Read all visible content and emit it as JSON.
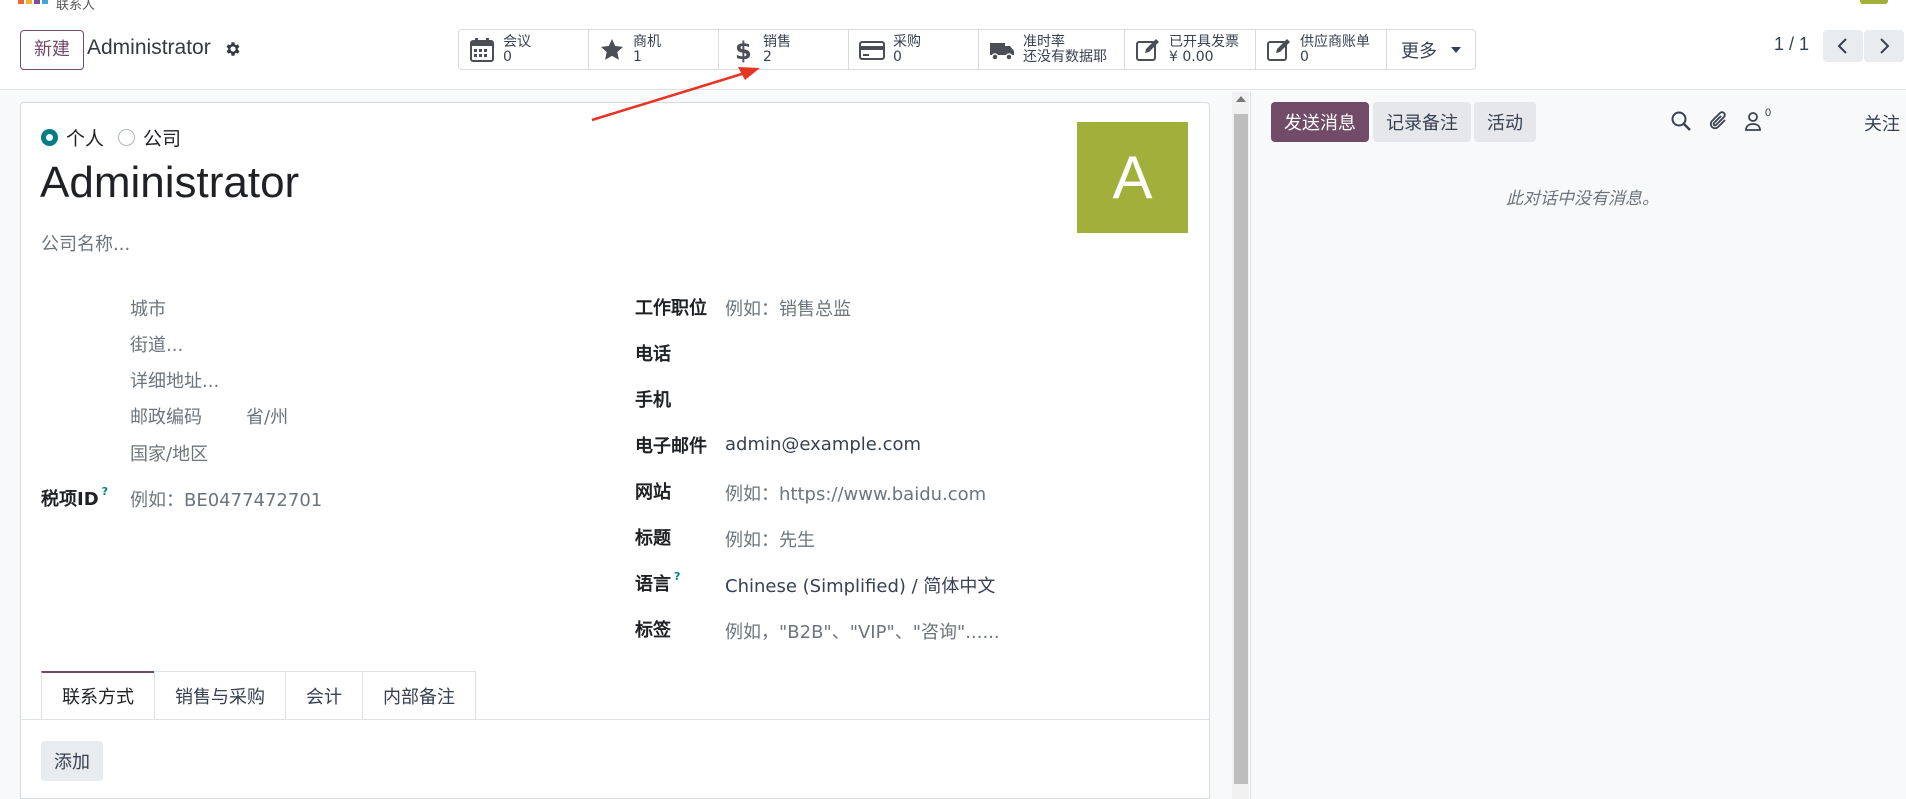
{
  "app": {
    "brand_colors": [
      "#e8663b",
      "#f2b134",
      "#7c4f99",
      "#3fa7d6"
    ],
    "top_label": "联系人"
  },
  "control": {
    "new_label": "新建",
    "breadcrumb": "Administrator",
    "smart_buttons": [
      {
        "icon": "calendar-icon",
        "label": "会议",
        "value": "0"
      },
      {
        "icon": "star-icon",
        "label": "商机",
        "value": "1"
      },
      {
        "icon": "dollar-icon",
        "label": "销售",
        "value": "2"
      },
      {
        "icon": "credit-card-icon",
        "label": "采购",
        "value": "0"
      },
      {
        "icon": "truck-icon",
        "label": "准时率",
        "value": "还没有数据耶"
      },
      {
        "icon": "invoice-edit-icon",
        "label": "已开具发票",
        "value": "¥ 0.00"
      },
      {
        "icon": "bill-edit-icon",
        "label": "供应商账单",
        "value": "0"
      }
    ],
    "more_label": "更多",
    "pager": "1 / 1"
  },
  "form": {
    "type_individual": "个人",
    "type_company": "公司",
    "name": "Administrator",
    "avatar_letter": "A",
    "company_placeholder": "公司名称...",
    "address": {
      "city": "城市",
      "street": "街道...",
      "street2": "详细地址...",
      "zip": "邮政编码",
      "state": "省/州",
      "country": "国家/地区"
    },
    "vat_label": "税项ID",
    "vat_help": "?",
    "vat_placeholder": "例如：BE0477472701",
    "right": {
      "job_label": "工作职位",
      "job_placeholder": "例如：销售总监",
      "phone_label": "电话",
      "mobile_label": "手机",
      "email_label": "电子邮件",
      "email_value": "admin@example.com",
      "website_label": "网站",
      "website_placeholder": "例如：https://www.baidu.com",
      "title_label": "标题",
      "title_placeholder": "例如：先生",
      "lang_label": "语言",
      "lang_help": "?",
      "lang_value": "Chinese (Simplified) / 简体中文",
      "tags_label": "标签",
      "tags_placeholder": "例如，\"B2B\"、\"VIP\"、\"咨询\"......"
    },
    "tabs": [
      "联系方式",
      "销售与采购",
      "会计",
      "内部备注"
    ],
    "add_label": "添加"
  },
  "chatter": {
    "send_label": "发送消息",
    "note_label": "记录备注",
    "activity_label": "活动",
    "followers_count": "0",
    "follow_label": "关注",
    "empty_text": "此对话中没有消息。"
  }
}
